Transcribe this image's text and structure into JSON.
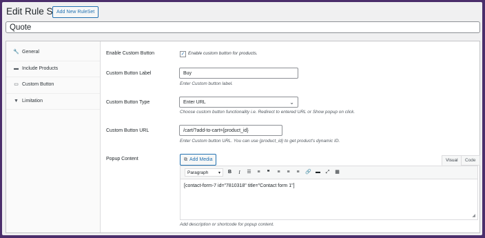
{
  "header": {
    "title": "Edit Rule Set",
    "add_new_label": "Add New RuleSet",
    "name_value": "Quote"
  },
  "tabs": [
    {
      "label": "General",
      "icon": "wrench-icon"
    },
    {
      "label": "Include Products",
      "icon": "lock-icon"
    },
    {
      "label": "Custom Button",
      "icon": "button-icon"
    },
    {
      "label": "Limitation",
      "icon": "filter-icon"
    }
  ],
  "fields": {
    "enable": {
      "label": "Enable Custom Button",
      "checkbox_label": "Enable custom button for products.",
      "checked": true
    },
    "button_label": {
      "label": "Custom Button Label",
      "value": "Buy",
      "description": "Enter Custom button label."
    },
    "button_type": {
      "label": "Custom Button Type",
      "selected": "Enter URL",
      "description": "Choose custom button functionality i.e. Redirect to entered URL or Show popup on click."
    },
    "button_url": {
      "label": "Custom Button URL",
      "value": "/cart/?add-to-cart={product_id}",
      "description": "Enter Custom button URL. You can use {product_id} to get product's dynamic ID."
    },
    "popup": {
      "label": "Popup Content",
      "add_media_label": "Add Media",
      "tab_visual": "Visual",
      "tab_code": "Code",
      "format_select": "Paragraph",
      "content": "[contact-form-7 id=\"7810318\" title=\"Contact form 1\"]",
      "description": "Add description or shortcode for popup content."
    }
  },
  "colors": {
    "accent": "#2271b1",
    "frame_border": "#4b2e6b"
  }
}
